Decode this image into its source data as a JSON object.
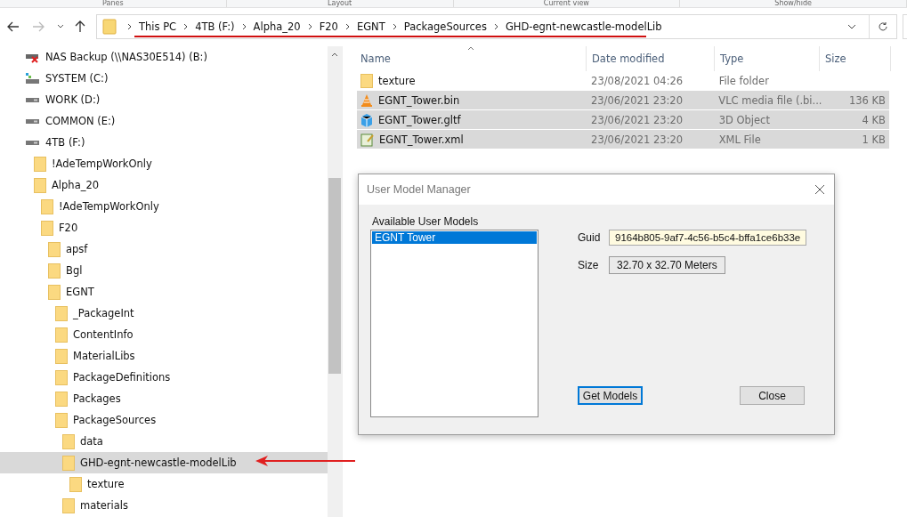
{
  "ribbon_groups": [
    "Panes",
    "Layout",
    "Current view",
    "Show/hide"
  ],
  "address_bar": {
    "path": [
      "This PC",
      "4TB (F:)",
      "Alpha_20",
      "F20",
      "EGNT",
      "PackageSources",
      "GHD-egnt-newcastle-modelLib"
    ]
  },
  "navigation_tree": [
    {
      "label": "NAS Backup (\\\\NAS30E514) (B:)",
      "kind": "network-drive",
      "selected": false
    },
    {
      "label": "SYSTEM (C:)",
      "kind": "system-drive",
      "selected": false
    },
    {
      "label": "WORK (D:)",
      "kind": "drive",
      "selected": false
    },
    {
      "label": "COMMON (E:)",
      "kind": "drive",
      "selected": false
    },
    {
      "label": "4TB (F:)",
      "kind": "drive",
      "selected": false,
      "children": [
        {
          "label": "!AdeTempWorkOnly",
          "kind": "folder",
          "selected": false
        },
        {
          "label": "Alpha_20",
          "kind": "folder",
          "selected": false,
          "children": [
            {
              "label": "!AdeTempWorkOnly",
              "kind": "folder",
              "selected": false
            },
            {
              "label": "F20",
              "kind": "folder",
              "selected": false,
              "children": [
                {
                  "label": "apsf",
                  "kind": "folder",
                  "selected": false
                },
                {
                  "label": "Bgl",
                  "kind": "folder",
                  "selected": false
                },
                {
                  "label": "EGNT",
                  "kind": "folder",
                  "selected": false,
                  "children": [
                    {
                      "label": "_PackageInt",
                      "kind": "folder",
                      "selected": false
                    },
                    {
                      "label": "ContentInfo",
                      "kind": "folder",
                      "selected": false
                    },
                    {
                      "label": "MaterialLibs",
                      "kind": "folder",
                      "selected": false
                    },
                    {
                      "label": "PackageDefinitions",
                      "kind": "folder",
                      "selected": false
                    },
                    {
                      "label": "Packages",
                      "kind": "folder",
                      "selected": false
                    },
                    {
                      "label": "PackageSources",
                      "kind": "folder",
                      "selected": false,
                      "children": [
                        {
                          "label": "data",
                          "kind": "folder",
                          "selected": false
                        },
                        {
                          "label": "GHD-egnt-newcastle-modelLib",
                          "kind": "folder",
                          "selected": true,
                          "children": [
                            {
                              "label": "texture",
                              "kind": "folder",
                              "selected": false
                            }
                          ]
                        },
                        {
                          "label": "materials",
                          "kind": "folder",
                          "selected": false
                        }
                      ]
                    }
                  ]
                }
              ]
            }
          ]
        }
      ]
    }
  ],
  "file_list": {
    "columns": [
      "Name",
      "Date modified",
      "Type",
      "Size"
    ],
    "rows": [
      {
        "name": "texture",
        "kind": "folder",
        "date": "23/08/2021 04:26",
        "type": "File folder",
        "size": "",
        "selected": false
      },
      {
        "name": "EGNT_Tower.bin",
        "kind": "vlc",
        "date": "23/06/2021 23:20",
        "type": "VLC media file (.bi...",
        "size": "136 KB",
        "selected": true
      },
      {
        "name": "EGNT_Tower.gltf",
        "kind": "model",
        "date": "23/06/2021 23:20",
        "type": "3D Object",
        "size": "4 KB",
        "selected": true
      },
      {
        "name": "EGNT_Tower.xml",
        "kind": "xml",
        "date": "23/06/2021 23:20",
        "type": "XML File",
        "size": "1 KB",
        "selected": true
      }
    ]
  },
  "dialog": {
    "title": "User Model Manager",
    "list_label": "Available User Models",
    "models": [
      {
        "label": "EGNT Tower",
        "selected": true
      }
    ],
    "guid_label": "Guid",
    "guid": "9164b805-9af7-4c56-b5c4-bffa1ce6b33e",
    "size_label": "Size",
    "size": "32.70 x 32.70 Meters",
    "buttons": [
      {
        "label": "Get Models",
        "focused": true
      },
      {
        "label": "Close",
        "focused": false
      }
    ]
  }
}
